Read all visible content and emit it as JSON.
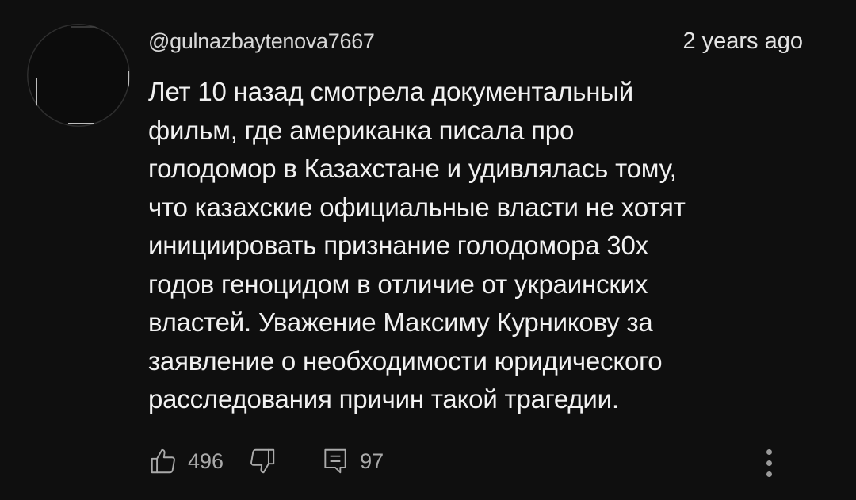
{
  "comment": {
    "author": "@gulnazbaytenova7667",
    "time": "2 years ago",
    "text": "Лет 10 назад смотрела документальный\nфильм, где американка писала про\nголодомор в Казахстане и удивлялась тому,\nчто казахские официальные власти не хотят\nинициировать признание голодомора 30х\nгодов геноцидом в отличие от украинских\nвластей. Уважение Максиму Курникову за\nзаявление о необходимости юридического\nрасследования причин такой трагедии."
  },
  "actions": {
    "likes": "496",
    "replies": "97"
  },
  "icons": {
    "avatar": "avatar",
    "like": "thumbs-up-icon",
    "dislike": "thumbs-down-icon",
    "reply": "reply-icon",
    "more": "more-vertical-icon"
  },
  "colors": {
    "background": "#0f0f0f",
    "text": "#f1f1f1",
    "secondary": "#aaaaaa"
  }
}
